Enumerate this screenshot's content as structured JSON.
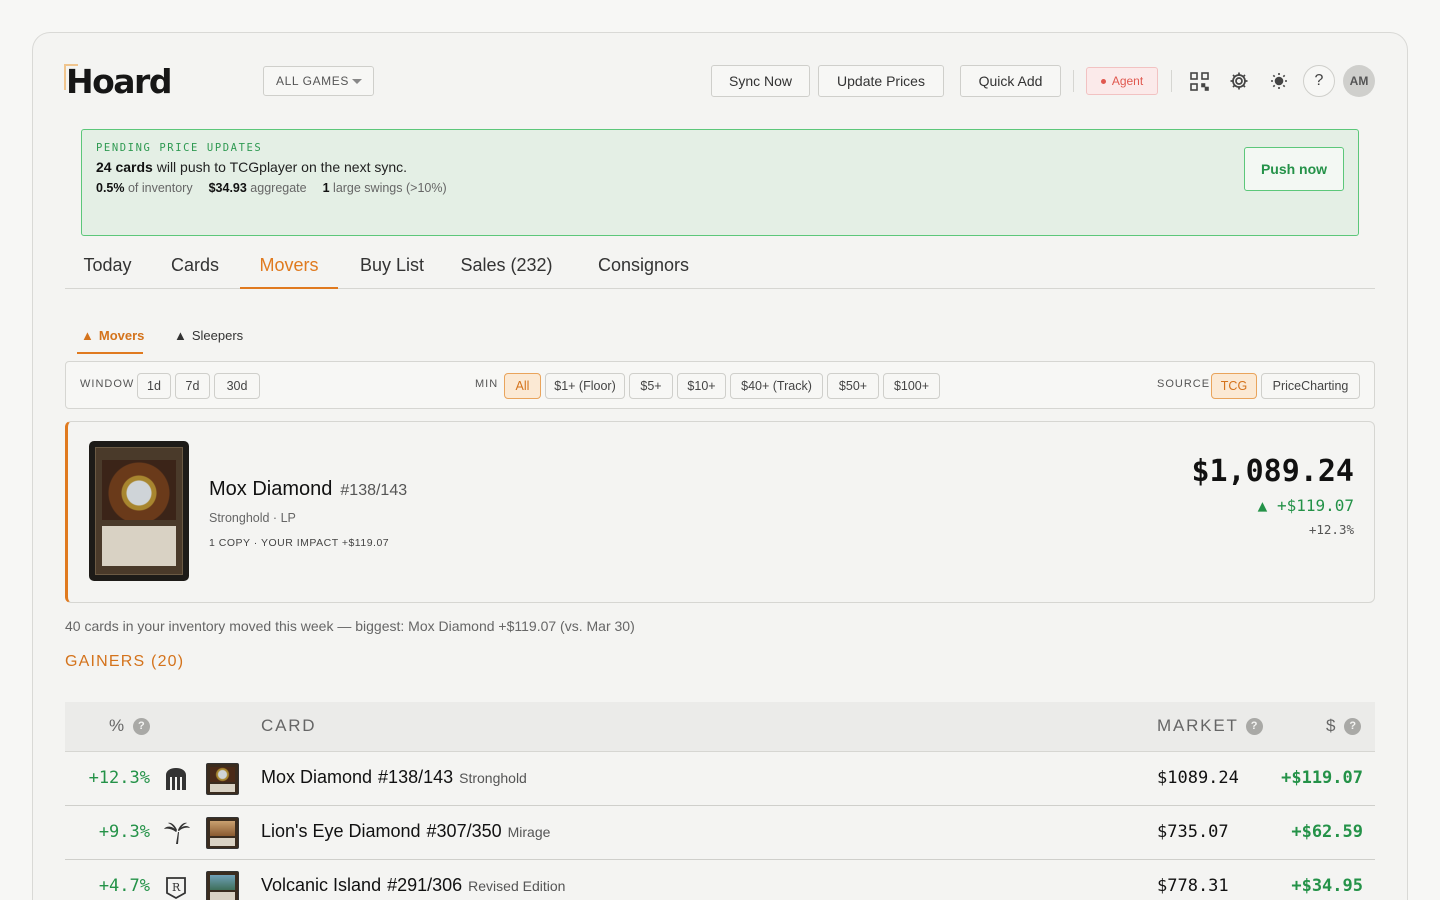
{
  "app": {
    "logo": "Hoard",
    "games_select": "ALL GAMES"
  },
  "header": {
    "buttons": [
      "Sync Now",
      "Update Prices",
      "Quick Add"
    ],
    "agent_label": "Agent",
    "help": "?",
    "avatar": "AM"
  },
  "banner": {
    "eyebrow": "PENDING PRICE UPDATES",
    "count": "24 cards",
    "message": " will push to TCGplayer on the next sync.",
    "stat1_value": "0.5%",
    "stat1_label": " of inventory",
    "stat2_value": "$34.93",
    "stat2_label": " aggregate",
    "stat3_value": "1",
    "stat3_label": " large swings (>10%)",
    "push_label": "Push now"
  },
  "tabs": [
    "Today",
    "Cards",
    "Movers",
    "Buy List",
    "Sales (232)",
    "Consignors"
  ],
  "active_tab": "Movers",
  "subtabs": {
    "movers": "Movers",
    "sleepers": "Sleepers"
  },
  "filters": {
    "window_label": "WINDOW",
    "window_options": [
      "1d",
      "7d",
      "30d"
    ],
    "min_label": "MIN",
    "min_options": [
      "All",
      "$1+ (Floor)",
      "$5+",
      "$10+",
      "$40+ (Track)",
      "$50+",
      "$100+"
    ],
    "min_selected": "All",
    "source_label": "SOURCE",
    "source_options": [
      "TCG",
      "PriceCharting"
    ],
    "source_selected": "TCG"
  },
  "hero": {
    "name": "Mox Diamond",
    "number": "#138/143",
    "set_condition": "Stronghold · LP",
    "impact": "1 COPY · YOUR IMPACT +$119.07",
    "price": "$1,089.24",
    "delta": "▲ +$119.07",
    "pct": "+12.3%"
  },
  "summary": "40 cards in your inventory moved this week — biggest: Mox Diamond +$119.07 (vs. Mar 30)",
  "gainers_title": "GAINERS (20)",
  "table": {
    "headers": {
      "pct": "%",
      "card": "CARD",
      "market": "MARKET",
      "dollar": "$"
    },
    "rows": [
      {
        "pct": "+12.3%",
        "set_icon": "stronghold-set-icon",
        "name": "Mox Diamond",
        "number": "#138/143",
        "set": "Stronghold",
        "market": "$1089.24",
        "gain": "+$119.07"
      },
      {
        "pct": "+9.3%",
        "set_icon": "mirage-set-icon",
        "name": "Lion's Eye Diamond",
        "number": "#307/350",
        "set": "Mirage",
        "market": "$735.07",
        "gain": "+$62.59"
      },
      {
        "pct": "+4.7%",
        "set_icon": "revised-set-icon",
        "name": "Volcanic Island",
        "number": "#291/306",
        "set": "Revised Edition",
        "market": "$778.31",
        "gain": "+$34.95"
      }
    ]
  },
  "colors": {
    "accent": "#e07a1f",
    "positive": "#249248",
    "banner_bg": "#e4efe5",
    "agent": "#e0584f"
  }
}
